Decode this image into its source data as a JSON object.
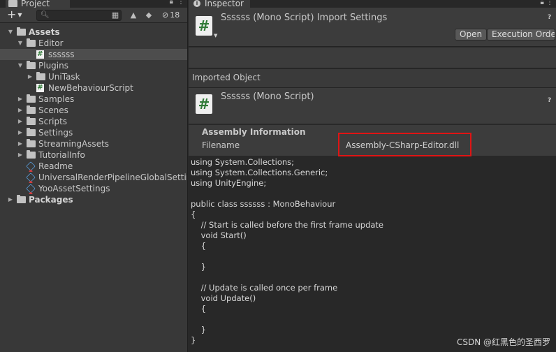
{
  "project_panel": {
    "tab_label": "Project",
    "visible_count": "18",
    "tree": [
      {
        "label": "Assets",
        "depth": 0,
        "kind": "folder",
        "expanded": true,
        "bold": true
      },
      {
        "label": "Editor",
        "depth": 1,
        "kind": "folder",
        "expanded": true
      },
      {
        "label": "ssssss",
        "depth": 2,
        "kind": "script",
        "selected": true
      },
      {
        "label": "Plugins",
        "depth": 1,
        "kind": "folder",
        "expanded": true
      },
      {
        "label": "UniTask",
        "depth": 2,
        "kind": "folder",
        "expanded": false
      },
      {
        "label": "NewBehaviourScript",
        "depth": 2,
        "kind": "script"
      },
      {
        "label": "Samples",
        "depth": 1,
        "kind": "folder",
        "expanded": false
      },
      {
        "label": "Scenes",
        "depth": 1,
        "kind": "folder",
        "expanded": false
      },
      {
        "label": "Scripts",
        "depth": 1,
        "kind": "folder",
        "expanded": false
      },
      {
        "label": "Settings",
        "depth": 1,
        "kind": "folder",
        "expanded": false
      },
      {
        "label": "StreamingAssets",
        "depth": 1,
        "kind": "folder",
        "expanded": false
      },
      {
        "label": "TutorialInfo",
        "depth": 1,
        "kind": "folder",
        "expanded": false
      },
      {
        "label": "Readme",
        "depth": 1,
        "kind": "asset"
      },
      {
        "label": "UniversalRenderPipelineGlobalSettings",
        "depth": 1,
        "kind": "asset"
      },
      {
        "label": "YooAssetSettings",
        "depth": 1,
        "kind": "asset"
      },
      {
        "label": "Packages",
        "depth": 0,
        "kind": "folder",
        "expanded": false,
        "bold": true
      }
    ]
  },
  "inspector": {
    "tab_label": "Inspector",
    "header_title": "Ssssss (Mono Script) Import Settings",
    "open_button": "Open",
    "execution_order_button": "Execution Order...",
    "imported_object_label": "Imported Object",
    "object_title": "Ssssss (Mono Script)",
    "assembly_heading": "Assembly Information",
    "filename_key": "Filename",
    "filename_value": "Assembly-CSharp-Editor.dll",
    "code": "using System.Collections;\nusing System.Collections.Generic;\nusing UnityEngine;\n\npublic class ssssss : MonoBehaviour\n{\n    // Start is called before the first frame update\n    void Start()\n    {\n\n    }\n\n    // Update is called once per frame\n    void Update()\n    {\n\n    }\n}"
  },
  "watermark": "CSDN @红黑色的圣西罗",
  "colors": {
    "highlight_box": "#e01414",
    "tab_accent": "#3a79bb",
    "script_icon_green": "#2f7a36"
  }
}
